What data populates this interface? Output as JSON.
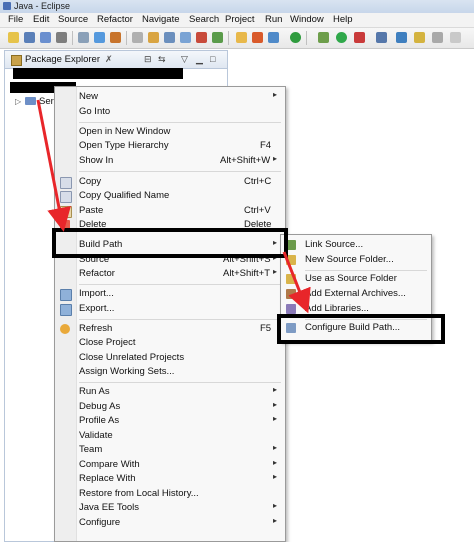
{
  "window": {
    "title": "Java - Eclipse"
  },
  "menubar": {
    "items": [
      "File",
      "Edit",
      "Source",
      "Refactor",
      "Navigate",
      "Search",
      "Project",
      "Run",
      "Window",
      "Help"
    ]
  },
  "panel": {
    "title": "Package Explorer",
    "close_glyph": "✗",
    "tree_item": "Ser"
  },
  "context_menu": {
    "items": [
      {
        "label": "New",
        "arrow": "▸"
      },
      {
        "label": "Go Into"
      },
      {
        "label": "Open in New Window"
      },
      {
        "label": "Open Type Hierarchy",
        "shortcut": "F4"
      },
      {
        "label": "Show In",
        "shortcut": "Alt+Shift+W",
        "arrow": "▸"
      },
      {
        "label": "Copy",
        "shortcut": "Ctrl+C"
      },
      {
        "label": "Copy Qualified Name"
      },
      {
        "label": "Paste",
        "shortcut": "Ctrl+V"
      },
      {
        "label": "Delete",
        "shortcut": "Delete"
      },
      {
        "label": "Build Path",
        "arrow": "▸"
      },
      {
        "label": "Source",
        "shortcut": "Alt+Shift+S",
        "arrow": "▸"
      },
      {
        "label": "Refactor",
        "shortcut": "Alt+Shift+T",
        "arrow": "▸"
      },
      {
        "label": "Import..."
      },
      {
        "label": "Export..."
      },
      {
        "label": "Refresh",
        "shortcut": "F5"
      },
      {
        "label": "Close Project"
      },
      {
        "label": "Close Unrelated Projects"
      },
      {
        "label": "Assign Working Sets..."
      },
      {
        "label": "Run As",
        "arrow": "▸"
      },
      {
        "label": "Debug As",
        "arrow": "▸"
      },
      {
        "label": "Profile As",
        "arrow": "▸"
      },
      {
        "label": "Validate"
      },
      {
        "label": "Team",
        "arrow": "▸"
      },
      {
        "label": "Compare With",
        "arrow": "▸"
      },
      {
        "label": "Replace With",
        "arrow": "▸"
      },
      {
        "label": "Restore from Local History..."
      },
      {
        "label": "Java EE Tools",
        "arrow": "▸"
      },
      {
        "label": "Configure",
        "arrow": "▸"
      }
    ]
  },
  "build_path_submenu": {
    "items": [
      {
        "label": "Link Source..."
      },
      {
        "label": "New Source Folder..."
      },
      {
        "label": "Use as Source Folder"
      },
      {
        "label": "Add External Archives..."
      },
      {
        "label": "Add Libraries..."
      },
      {
        "label": "Configure Build Path..."
      }
    ]
  },
  "colors": {
    "highlight_border": "#000000",
    "arrow": "#e8262a"
  }
}
